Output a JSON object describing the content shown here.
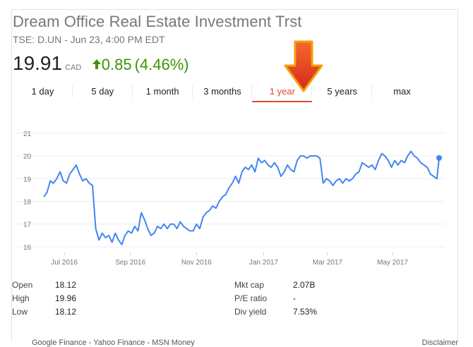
{
  "header": {
    "title": "Dream Office Real Estate Investment Trst",
    "subtitle": "TSE: D.UN - Jun 23, 4:00 PM EDT",
    "price": "19.91",
    "currency": "CAD",
    "change": "0.85",
    "change_pct": "(4.46%)",
    "up_color": "#3d9400"
  },
  "tabs": [
    {
      "label": "1 day"
    },
    {
      "label": "5 day"
    },
    {
      "label": "1 month"
    },
    {
      "label": "3 months"
    },
    {
      "label": "1 year",
      "active": true
    },
    {
      "label": "5 years"
    },
    {
      "label": "max"
    }
  ],
  "chart_data": {
    "type": "line",
    "line_color": "#4285f4",
    "grid": true,
    "ylim": [
      15.75,
      21.15
    ],
    "yticks": [
      "16",
      "17",
      "18",
      "19",
      "20",
      "21"
    ],
    "xticks": [
      "Jul 2016",
      "Sep 2016",
      "Nov 2016",
      "Jan 2017",
      "Mar 2017",
      "May 2017"
    ],
    "x_range_days": [
      0,
      365
    ],
    "xtick_days": [
      19,
      80,
      141,
      203,
      262,
      322
    ],
    "series": [
      {
        "x": [
          0,
          3,
          6,
          9,
          12,
          15,
          18,
          21,
          24,
          27,
          30,
          33,
          36,
          39,
          42,
          45,
          48,
          51,
          54,
          57,
          60,
          63,
          66,
          69,
          72,
          75,
          78,
          81,
          84,
          87,
          90,
          93,
          96,
          99,
          102,
          105,
          108,
          111,
          114,
          117,
          120,
          123,
          126,
          129,
          132,
          135,
          138,
          141,
          144,
          147,
          150,
          153,
          156,
          159,
          162,
          165,
          168,
          171,
          174,
          177,
          180,
          183,
          186,
          189,
          192,
          195,
          198,
          201,
          204,
          207,
          210,
          213,
          216,
          219,
          222,
          225,
          228,
          231,
          234,
          237,
          240,
          243,
          246,
          249,
          252,
          255,
          258,
          261,
          264,
          267,
          270,
          273,
          276,
          279,
          282,
          285,
          288,
          291,
          294,
          297,
          300,
          303,
          306,
          309,
          312,
          315,
          318,
          321,
          324,
          327,
          330,
          333,
          336,
          339,
          342,
          345,
          348,
          351,
          354,
          357,
          360,
          363,
          365
        ],
        "y": [
          18.2,
          18.4,
          18.9,
          18.8,
          19.0,
          19.3,
          18.9,
          18.8,
          19.2,
          19.4,
          19.6,
          19.2,
          18.9,
          19.0,
          18.8,
          18.7,
          16.8,
          16.3,
          16.6,
          16.4,
          16.5,
          16.2,
          16.6,
          16.3,
          16.1,
          16.5,
          16.7,
          16.6,
          16.9,
          16.7,
          17.5,
          17.2,
          16.8,
          16.5,
          16.6,
          16.9,
          16.8,
          17.0,
          16.8,
          17.0,
          17.0,
          16.8,
          17.1,
          16.9,
          16.8,
          16.7,
          16.7,
          17.0,
          16.8,
          17.3,
          17.5,
          17.6,
          17.8,
          17.7,
          18.0,
          18.2,
          18.3,
          18.6,
          18.8,
          19.1,
          18.8,
          19.3,
          19.5,
          19.4,
          19.6,
          19.3,
          19.9,
          19.7,
          19.8,
          19.6,
          19.5,
          19.7,
          19.5,
          19.1,
          19.3,
          19.6,
          19.4,
          19.3,
          19.8,
          20.0,
          20.0,
          19.9,
          20.0,
          20.0,
          20.0,
          19.9,
          18.8,
          19.0,
          18.9,
          18.7,
          18.9,
          19.0,
          18.8,
          19.0,
          18.9,
          19.0,
          19.2,
          19.3,
          19.7,
          19.6,
          19.5,
          19.6,
          19.4,
          19.8,
          20.1,
          20.0,
          19.8,
          19.5,
          19.8,
          19.6,
          19.8,
          19.7,
          20.0,
          20.2,
          20.0,
          19.9,
          19.7,
          19.6,
          19.5,
          19.2,
          19.1,
          19.0,
          19.91
        ]
      }
    ]
  },
  "stats": {
    "left": [
      {
        "label": "Open",
        "value": "18.12"
      },
      {
        "label": "High",
        "value": "19.96"
      },
      {
        "label": "Low",
        "value": "18.12"
      }
    ],
    "right": [
      {
        "label": "Mkt cap",
        "value": "2.07B"
      },
      {
        "label": "P/E ratio",
        "value": "-"
      },
      {
        "label": "Div yield",
        "value": "7.53%"
      }
    ]
  },
  "footer": {
    "sources": "Google Finance - Yahoo Finance - MSN Money",
    "disclaimer": "Disclaimer"
  }
}
